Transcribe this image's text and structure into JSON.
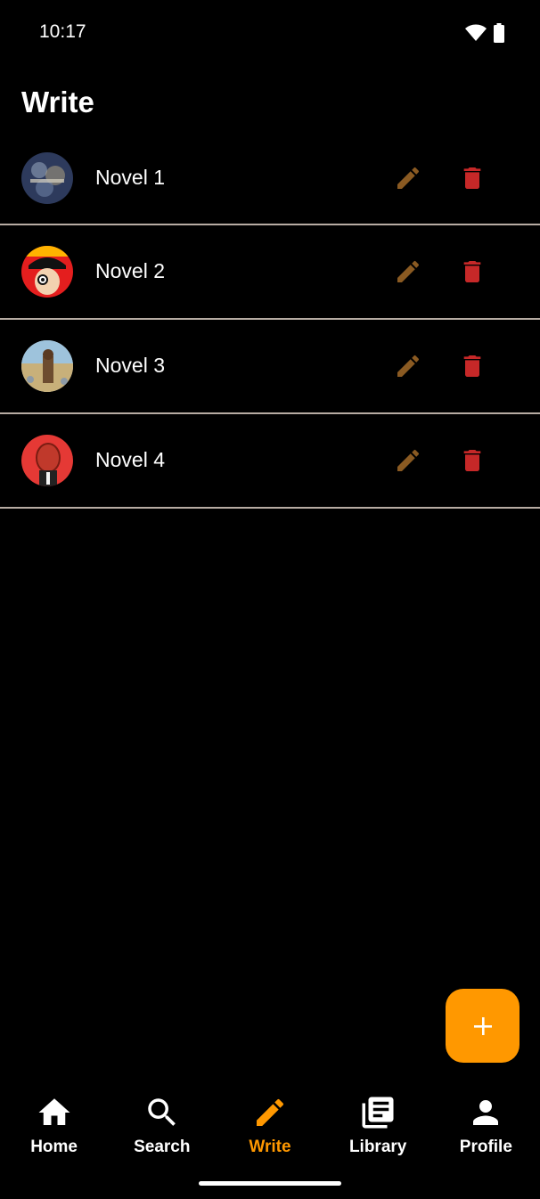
{
  "status_bar": {
    "time": "10:17",
    "icons": [
      "wifi-icon",
      "battery-icon"
    ]
  },
  "header": {
    "title": "Write"
  },
  "novels": [
    {
      "title": "Novel 1",
      "cover_icon": "cover-image-1",
      "edit_icon": "pencil-icon",
      "delete_icon": "trash-icon"
    },
    {
      "title": "Novel 2",
      "cover_icon": "cover-image-2",
      "edit_icon": "pencil-icon",
      "delete_icon": "trash-icon"
    },
    {
      "title": "Novel 3",
      "cover_icon": "cover-image-3",
      "edit_icon": "pencil-icon",
      "delete_icon": "trash-icon"
    },
    {
      "title": "Novel 4",
      "cover_icon": "cover-image-4",
      "edit_icon": "pencil-icon",
      "delete_icon": "trash-icon"
    }
  ],
  "fab": {
    "icon": "plus-icon"
  },
  "bottom_nav": {
    "items": [
      {
        "label": "Home",
        "icon": "home-icon",
        "active": false
      },
      {
        "label": "Search",
        "icon": "search-icon",
        "active": false
      },
      {
        "label": "Write",
        "icon": "pencil-icon",
        "active": true
      },
      {
        "label": "Library",
        "icon": "library-icon",
        "active": false
      },
      {
        "label": "Profile",
        "icon": "person-icon",
        "active": false
      }
    ]
  },
  "colors": {
    "background": "#000000",
    "accent": "#ff9800",
    "edit_icon": "#8a5a22",
    "delete_icon": "#c62828",
    "divider": "#b7aca3",
    "text": "#ffffff"
  }
}
